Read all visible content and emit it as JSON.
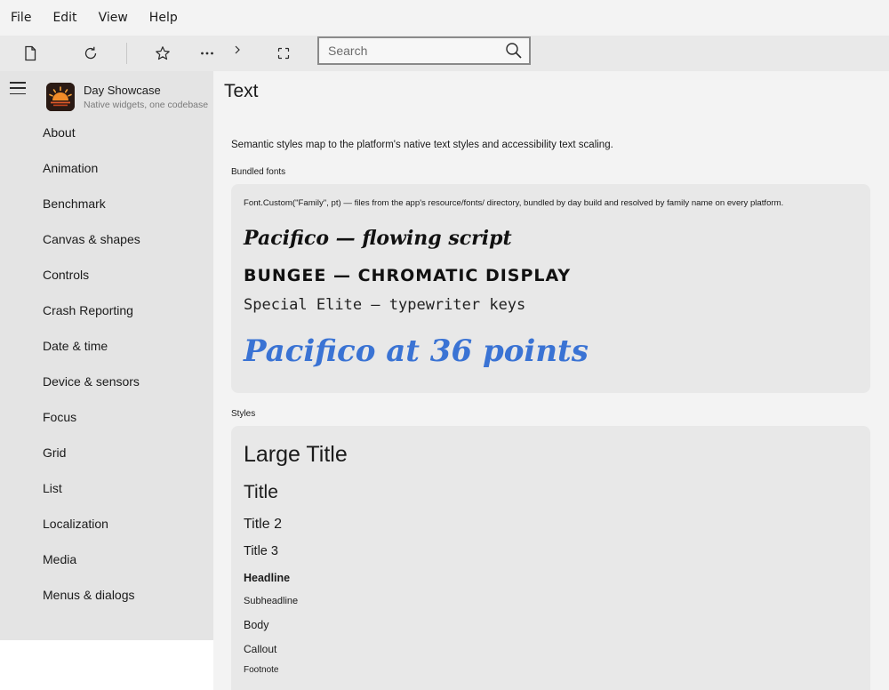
{
  "menu": [
    "File",
    "Edit",
    "View",
    "Help"
  ],
  "search": {
    "placeholder": "Search"
  },
  "app": {
    "title": "Day Showcase",
    "subtitle": "Native widgets, one codebase"
  },
  "nav": [
    "About",
    "Animation",
    "Benchmark",
    "Canvas & shapes",
    "Controls",
    "Crash Reporting",
    "Date & time",
    "Device & sensors",
    "Focus",
    "Grid",
    "List",
    "Localization",
    "Media",
    "Menus & dialogs"
  ],
  "page": {
    "title": "Text",
    "intro": "Semantic styles map to the platform's native text styles and accessibility text scaling.",
    "bundled_label": "Bundled fonts",
    "bundled_note": "Font.Custom(\"Family\", pt) — files from the app's resource/fonts/ directory, bundled by day build and resolved by family name on every platform.",
    "samples": [
      "Pacifico — flowing script",
      "BUNGEE — CHROMATIC DISPLAY",
      "Special Elite — typewriter keys",
      "Pacifico at 36 points"
    ],
    "styles_label": "Styles",
    "styles": [
      "Large Title",
      "Title",
      "Title 2",
      "Title 3",
      "Headline",
      "Subheadline",
      "Body",
      "Callout",
      "Footnote"
    ]
  },
  "colors": {
    "accent_blue": "#3a73d4",
    "sidebar_bg": "#e4e4e4",
    "content_bg": "#f3f3f3",
    "card_bg": "#e8e8e8"
  }
}
